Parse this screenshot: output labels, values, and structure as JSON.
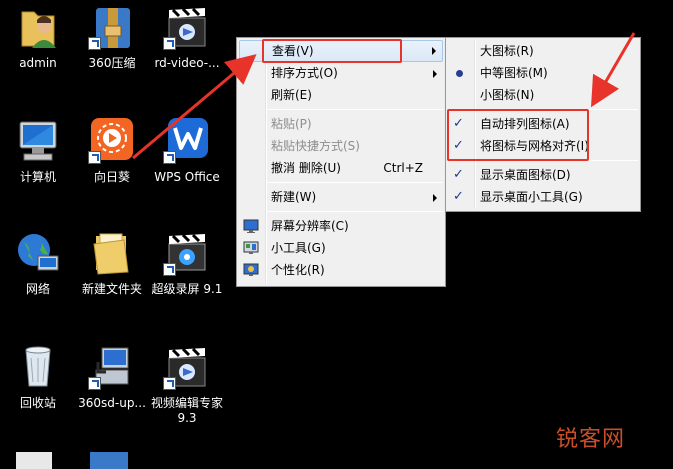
{
  "desktop_icons": [
    {
      "label": "admin",
      "icon": "user-folder-icon"
    },
    {
      "label": "360压缩",
      "icon": "archive-icon"
    },
    {
      "label": "rd-video-...",
      "icon": "video-clapper-icon"
    },
    {
      "label": "计算机",
      "icon": "computer-icon"
    },
    {
      "label": "向日葵",
      "icon": "sunflower-app-icon"
    },
    {
      "label": "WPS Office",
      "icon": "wps-icon"
    },
    {
      "label": "网络",
      "icon": "network-globe-icon"
    },
    {
      "label": "新建文件夹",
      "icon": "folder-icon"
    },
    {
      "label": "超级录屏 9.1",
      "icon": "screen-recorder-icon"
    },
    {
      "label": "回收站",
      "icon": "recycle-bin-icon"
    },
    {
      "label": "360sd-up...",
      "icon": "installer-icon"
    },
    {
      "label": "视频编辑专家 9.3",
      "icon": "video-editor-icon"
    }
  ],
  "context_menu": {
    "items": [
      {
        "label": "查看(V)",
        "submenu": true
      },
      {
        "label": "排序方式(O)",
        "submenu": true
      },
      {
        "label": "刷新(E)"
      },
      {
        "label": "粘贴(P)",
        "disabled": true
      },
      {
        "label": "粘贴快捷方式(S)",
        "disabled": true
      },
      {
        "label": "撤消 删除(U)",
        "shortcut": "Ctrl+Z"
      },
      {
        "label": "新建(W)",
        "submenu": true
      },
      {
        "label": "屏幕分辨率(C)",
        "icon": "display-icon"
      },
      {
        "label": "小工具(G)",
        "icon": "gadgets-icon"
      },
      {
        "label": "个性化(R)",
        "icon": "personalize-icon"
      }
    ]
  },
  "view_submenu": {
    "items": [
      {
        "label": "大图标(R)"
      },
      {
        "label": "中等图标(M)",
        "selected": true
      },
      {
        "label": "小图标(N)"
      },
      {
        "label": "自动排列图标(A)",
        "checked": true
      },
      {
        "label": "将图标与网格对齐(I)",
        "checked": true
      },
      {
        "label": "显示桌面图标(D)",
        "checked": true
      },
      {
        "label": "显示桌面小工具(G)",
        "checked": true
      }
    ]
  },
  "watermark": "锐客网",
  "colors": {
    "annotation_red": "#e8332a",
    "desktop_bg": "#000000"
  }
}
